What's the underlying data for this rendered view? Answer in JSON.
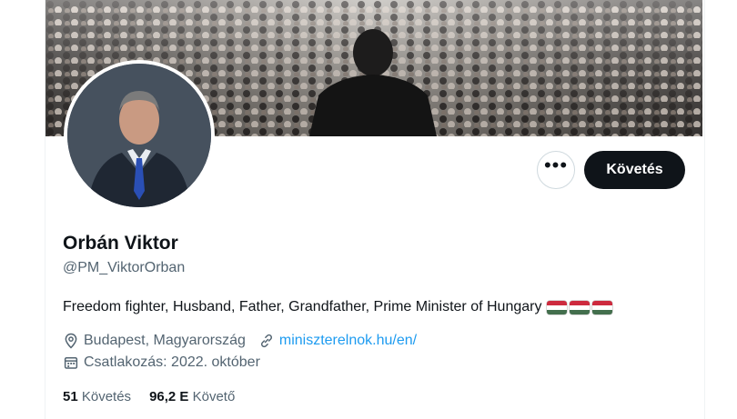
{
  "profile": {
    "name": "Orbán Viktor",
    "handle": "@PM_ViktorOrban",
    "bio": "Freedom fighter, Husband, Father, Grandfather, Prime Minister of Hungary",
    "bio_flags": [
      "hungary-flag",
      "hungary-flag",
      "hungary-flag"
    ],
    "location": "Budapest, Magyarország",
    "website": "miniszterelnok.hu/en/",
    "joined": "Csatlakozás: 2022. október"
  },
  "actions": {
    "more_label": "•••",
    "follow_label": "Követés"
  },
  "stats": {
    "following_count": "51",
    "following_label": "Követés",
    "followers_count": "96,2 E",
    "followers_label": "Követő"
  },
  "icons": {
    "location": "location-pin-icon",
    "link": "link-icon",
    "calendar": "calendar-icon"
  },
  "colors": {
    "accent": "#1d9bf0",
    "primary_text": "#0f1419",
    "secondary_text": "#536471",
    "follow_button": "#0f1419",
    "flag_red": "#cd2a3e",
    "flag_white": "#ffffff",
    "flag_green": "#436f4d"
  }
}
